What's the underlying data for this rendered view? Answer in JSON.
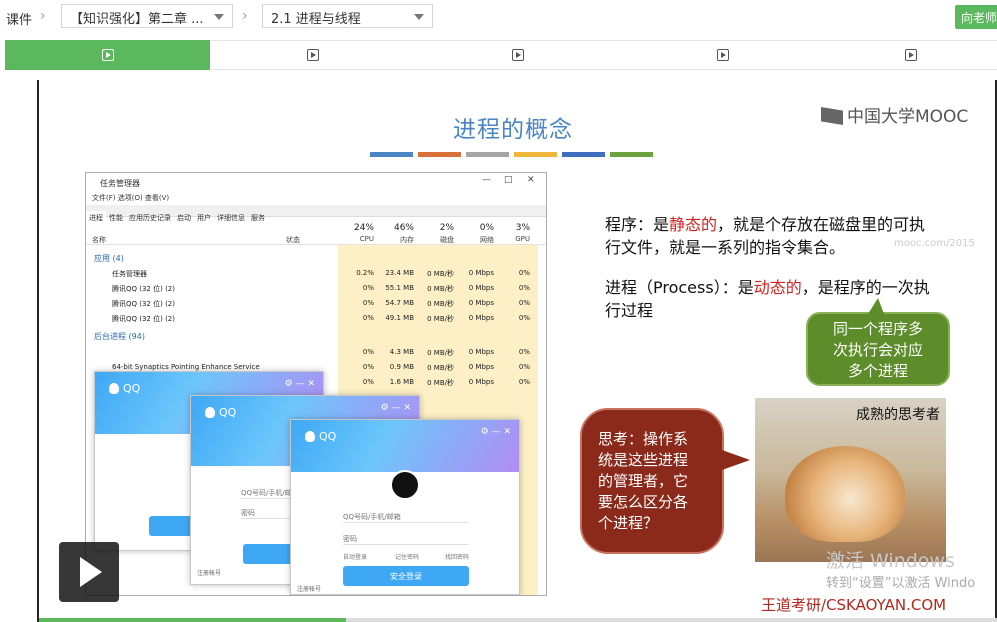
{
  "breadcrumb": {
    "root": "课件",
    "chapter_select": "【知识强化】第二章 ...",
    "section_select": "2.1 进程与线程"
  },
  "teacher_button": "向老师",
  "colors": {
    "accent": "#5cb85c",
    "title": "#4a86c5",
    "red": "#d32222"
  },
  "lesson_tabs": [
    {
      "icon": "video-play-icon",
      "active": true
    },
    {
      "icon": "video-play-icon",
      "active": false
    },
    {
      "icon": "video-play-icon",
      "active": false
    },
    {
      "icon": "video-play-icon",
      "active": false
    },
    {
      "icon": "video-play-icon",
      "active": false
    }
  ],
  "slide": {
    "title": "进程的概念",
    "logo": "中国大学MOOC",
    "program_def": {
      "p1": "程序：是",
      "p2": "静态的",
      "p3": "，就是个存放在磁盘里的可执行文件，就是一系列的指令集合。"
    },
    "process_def": {
      "p1": "进程（Process）：是",
      "p2": "动态的",
      "p3": "，是程序的一次执行过程"
    },
    "green_bubble": [
      "同一个程序多",
      "次执行会对应",
      "多个进程"
    ],
    "red_bubble": [
      "思考：操作系",
      "统是这些进程",
      "的管理者，它",
      "要怎么区分各",
      "个进程？"
    ],
    "dog_caption": "成熟的思考者",
    "windows_activate": [
      "激活 Windows",
      "转到“设置”以激活 Windo"
    ],
    "credit": "王道考研/CSKAOYAN.COM"
  },
  "task_manager": {
    "title": "任务管理器",
    "menu": "文件(F)   选项(O)   查看(V)",
    "tabs": [
      "进程",
      "性能",
      "应用历史记录",
      "启动",
      "用户",
      "详细信息",
      "服务"
    ],
    "col_name": "名称",
    "col_status": "状态",
    "columns": [
      {
        "pct": "24%",
        "label": "CPU"
      },
      {
        "pct": "46%",
        "label": "内存"
      },
      {
        "pct": "2%",
        "label": "磁盘"
      },
      {
        "pct": "0%",
        "label": "网络"
      },
      {
        "pct": "3%",
        "label": "GPU"
      }
    ],
    "group_apps": "应用 (4)",
    "group_bg": "后台进程 (94)",
    "apps": [
      {
        "name": "任务管理器",
        "cpu": "0.2%",
        "mem": "23.4 MB",
        "disk": "0 MB/秒",
        "net": "0 Mbps",
        "gpu": "0%"
      },
      {
        "name": "腾讯QQ (32 位) (2)",
        "cpu": "0%",
        "mem": "55.1 MB",
        "disk": "0 MB/秒",
        "net": "0 Mbps",
        "gpu": "0%"
      },
      {
        "name": "腾讯QQ (32 位) (2)",
        "cpu": "0%",
        "mem": "54.7 MB",
        "disk": "0 MB/秒",
        "net": "0 Mbps",
        "gpu": "0%"
      },
      {
        "name": "腾讯QQ (32 位) (2)",
        "cpu": "0%",
        "mem": "49.1 MB",
        "disk": "0 MB/秒",
        "net": "0 Mbps",
        "gpu": "0%"
      }
    ],
    "bg": [
      {
        "name": "",
        "cpu": "0%",
        "mem": "4.3 MB",
        "disk": "0 MB/秒",
        "net": "0 Mbps",
        "gpu": "0%"
      },
      {
        "name": "64-bit Synaptics Pointing Enhance Service",
        "cpu": "0%",
        "mem": "0.9 MB",
        "disk": "0 MB/秒",
        "net": "0 Mbps",
        "gpu": "0%"
      },
      {
        "name": "",
        "cpu": "0%",
        "mem": "1.6 MB",
        "disk": "0 MB/秒",
        "net": "0 Mbps",
        "gpu": "0%"
      }
    ]
  },
  "qq_login": {
    "brand": "QQ",
    "account_placeholder": "QQ号码/手机/邮箱",
    "password_placeholder": "密码",
    "auto_login": "自动登录",
    "remember": "记住密码",
    "retrieve": "找回密码",
    "login_button": "安全登录",
    "register": "注册帐号"
  },
  "watermark": "mooc.com/2015",
  "progress": 0.32
}
